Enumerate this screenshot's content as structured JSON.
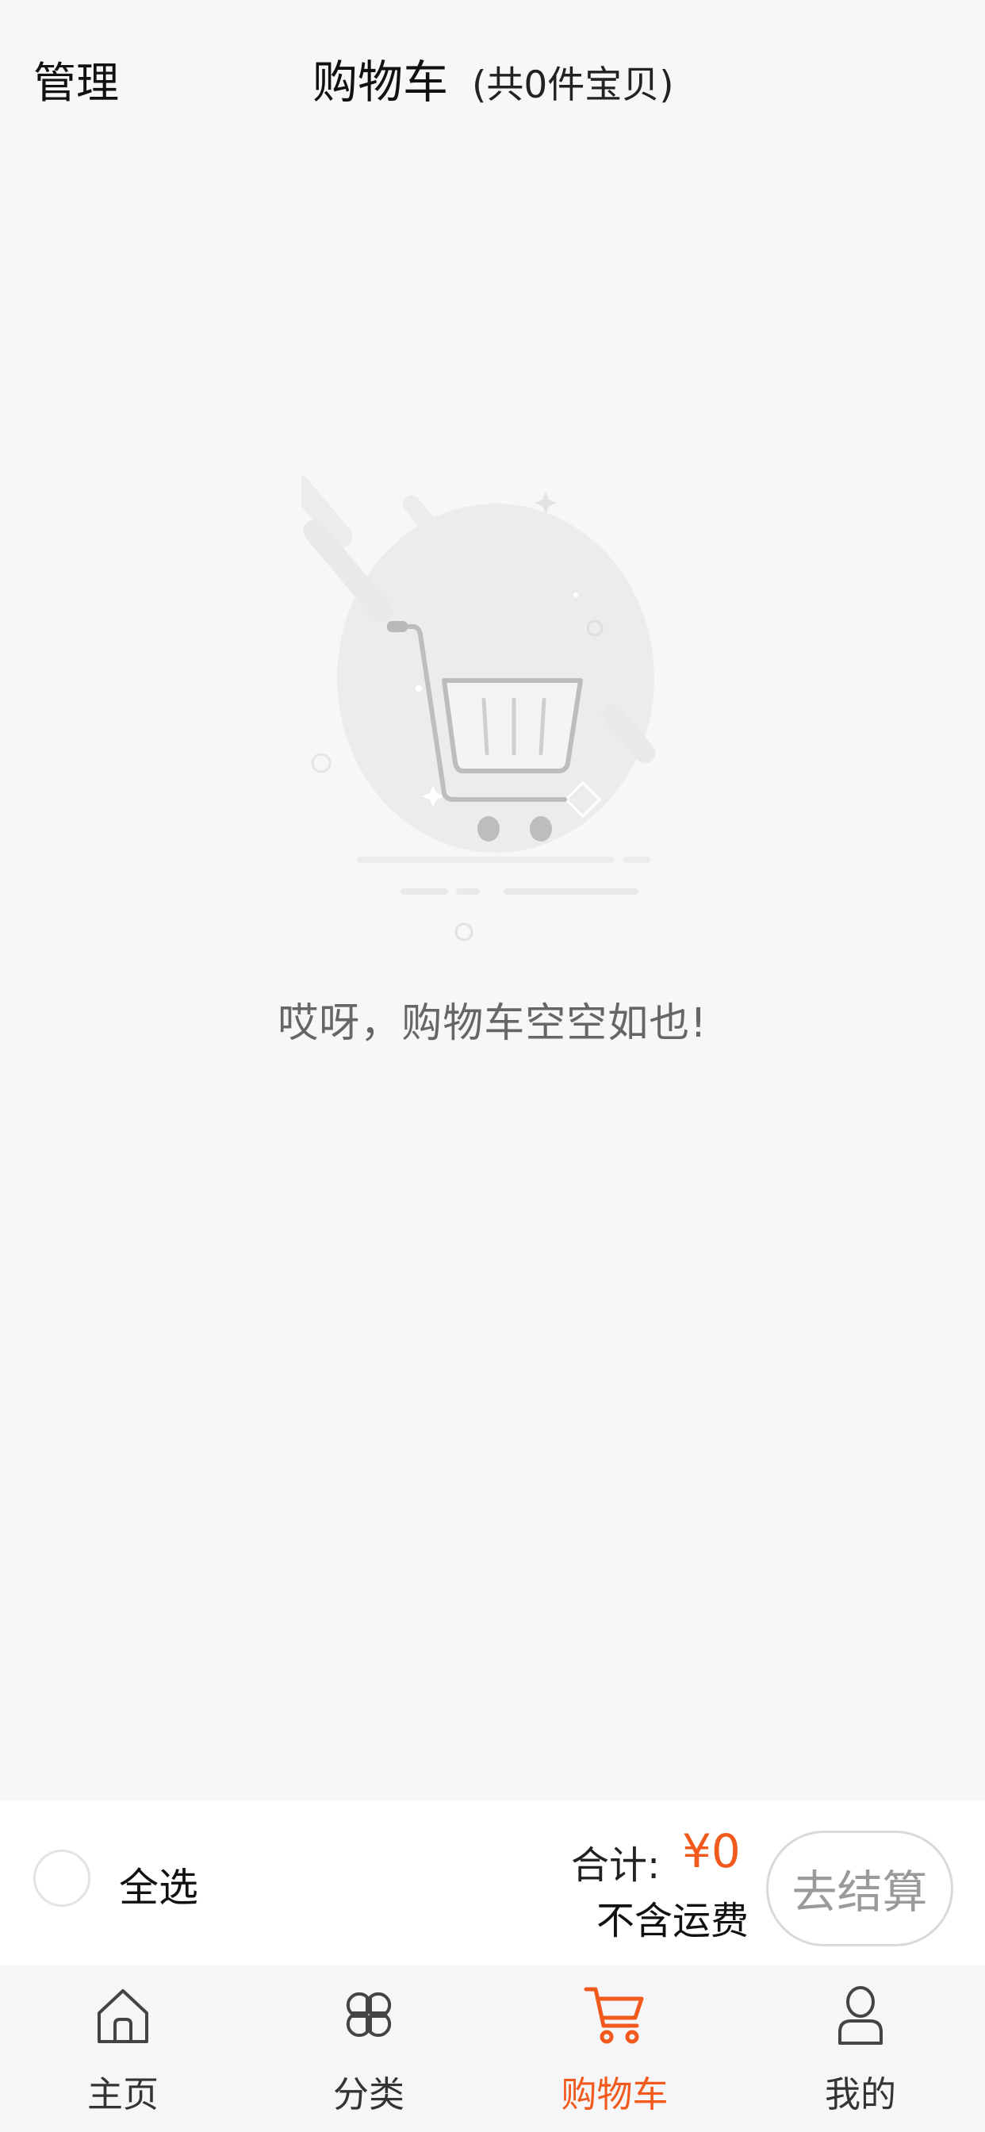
{
  "header": {
    "manage_label": "管理",
    "title": "购物车",
    "count_text": "(共0件宝贝)"
  },
  "empty_state": {
    "message": "哎呀，购物车空空如也!",
    "illustration_icon": "empty-cart-icon"
  },
  "checkout": {
    "select_all_label": "全选",
    "total_label": "合计:",
    "total_value": "¥0",
    "shipping_note": "不含运费",
    "checkout_label": "去结算",
    "accent_color": "#f25a1d"
  },
  "tabs": [
    {
      "label": "主页",
      "icon": "home-icon",
      "active": false
    },
    {
      "label": "分类",
      "icon": "category-icon",
      "active": false
    },
    {
      "label": "购物车",
      "icon": "cart-icon",
      "active": true
    },
    {
      "label": "我的",
      "icon": "profile-icon",
      "active": false
    }
  ]
}
